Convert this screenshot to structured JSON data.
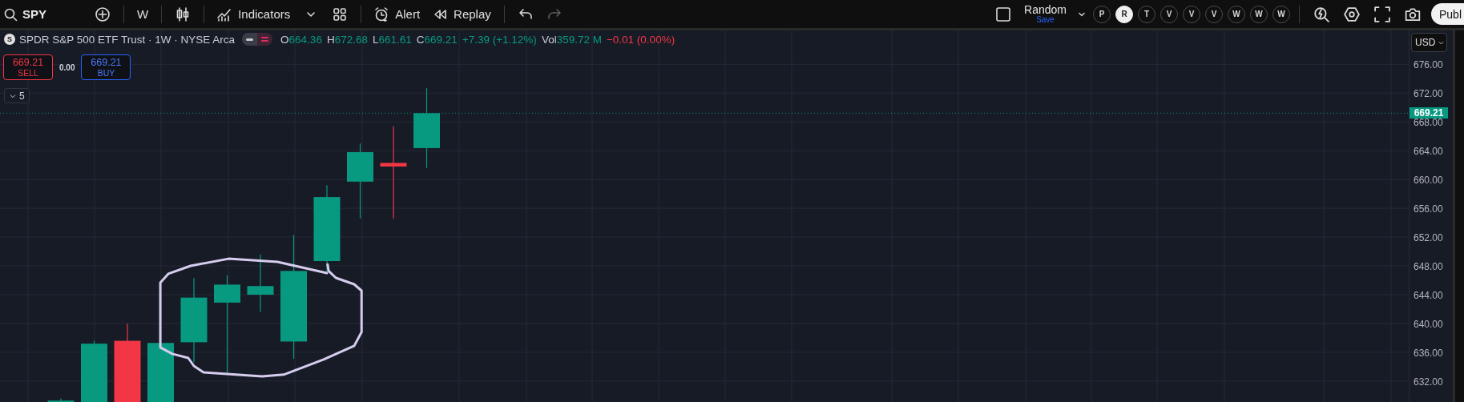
{
  "toolbar": {
    "symbol": "SPY",
    "items": [
      {
        "kind": "add"
      },
      {
        "kind": "divider"
      },
      {
        "kind": "text",
        "label": "W"
      },
      {
        "kind": "divider"
      },
      {
        "kind": "candles"
      },
      {
        "kind": "divider"
      },
      {
        "kind": "indicators",
        "label": "Indicators"
      },
      {
        "kind": "caret"
      },
      {
        "kind": "layouts"
      },
      {
        "kind": "divider"
      },
      {
        "kind": "alert",
        "label": "Alert"
      },
      {
        "kind": "replay",
        "label": "Replay"
      },
      {
        "kind": "divider"
      },
      {
        "kind": "undo",
        "disabled": false
      },
      {
        "kind": "redo",
        "disabled": true
      }
    ],
    "layout": {
      "name": "Random",
      "action": "Save"
    },
    "watchlists": [
      {
        "label": "P",
        "selected": false
      },
      {
        "label": "R",
        "selected": true
      },
      {
        "label": "T",
        "selected": false
      },
      {
        "label": "V",
        "selected": false
      },
      {
        "label": "V",
        "selected": false
      },
      {
        "label": "V",
        "selected": false
      },
      {
        "label": "W",
        "selected": false
      },
      {
        "label": "W",
        "selected": false
      },
      {
        "label": "W",
        "selected": false
      }
    ],
    "tools": [
      {
        "kind": "quick-search"
      },
      {
        "kind": "settings"
      },
      {
        "kind": "fullscreen"
      },
      {
        "kind": "camera"
      }
    ],
    "publish": "Publ"
  },
  "legend": {
    "logo": "S",
    "title": "SPDR S&P 500 ETF Trust · 1W · NYSE Arca",
    "ohlc": [
      {
        "label": "O",
        "value": "664.36"
      },
      {
        "label": "H",
        "value": "672.68"
      },
      {
        "label": "L",
        "value": "661.61"
      },
      {
        "label": "C",
        "value": "669.21"
      }
    ],
    "change": "+7.39 (+1.12%)",
    "volume_label": "Vol",
    "volume": "359.72 M",
    "volume_change": "−0.01 (0.00%)"
  },
  "trade": {
    "sell_price": "669.21",
    "sell_label": "SELL",
    "spread": "0.00",
    "buy_price": "669.21",
    "buy_label": "BUY"
  },
  "indicators_count": "5",
  "price_axis": {
    "currency": "USD",
    "labels": [
      "676.00",
      "672.00",
      "668.00",
      "664.00",
      "660.00",
      "656.00",
      "652.00",
      "648.00",
      "644.00",
      "640.00",
      "636.00",
      "632.00"
    ],
    "last_price": "669.21"
  }
}
